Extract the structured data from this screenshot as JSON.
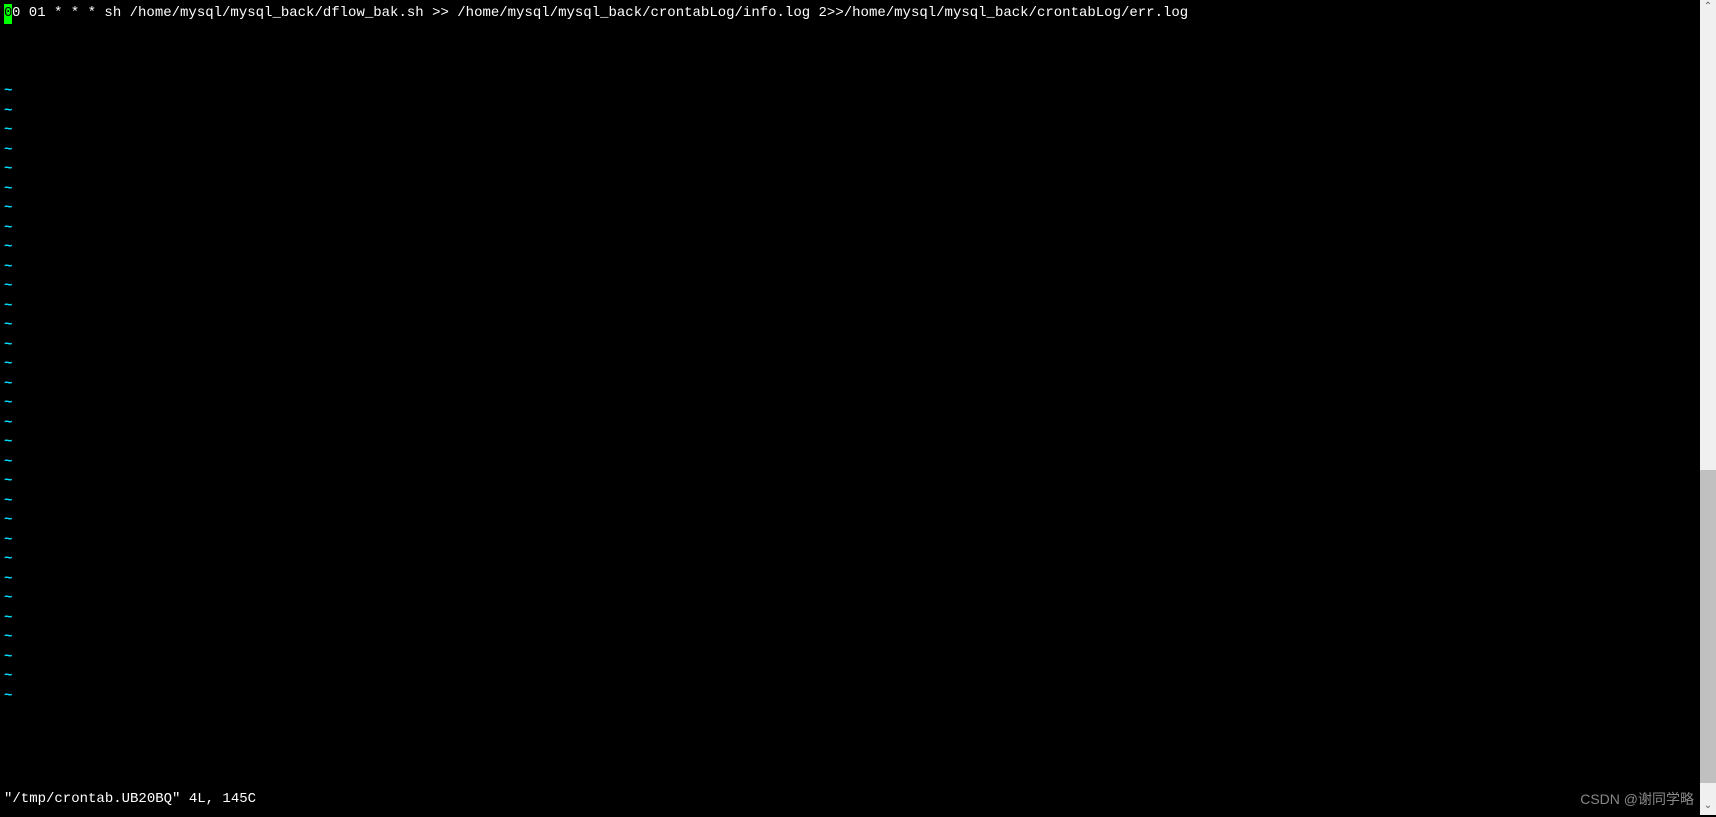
{
  "editor": {
    "cursor_char": "0",
    "first_line_text": "0 01 * * * sh /home/mysql/mysql_back/dflow_bak.sh >> /home/mysql/mysql_back/crontabLog/info.log 2>>/home/mysql/mysql_back/crontabLog/err.log",
    "tilde": "~",
    "status_line": "\"/tmp/crontab.UB20BQ\" 4L, 145C"
  },
  "scrollbar": {
    "up_arrow": "⌃",
    "down_arrow": "⌄"
  },
  "watermark": "CSDN @谢同学略"
}
